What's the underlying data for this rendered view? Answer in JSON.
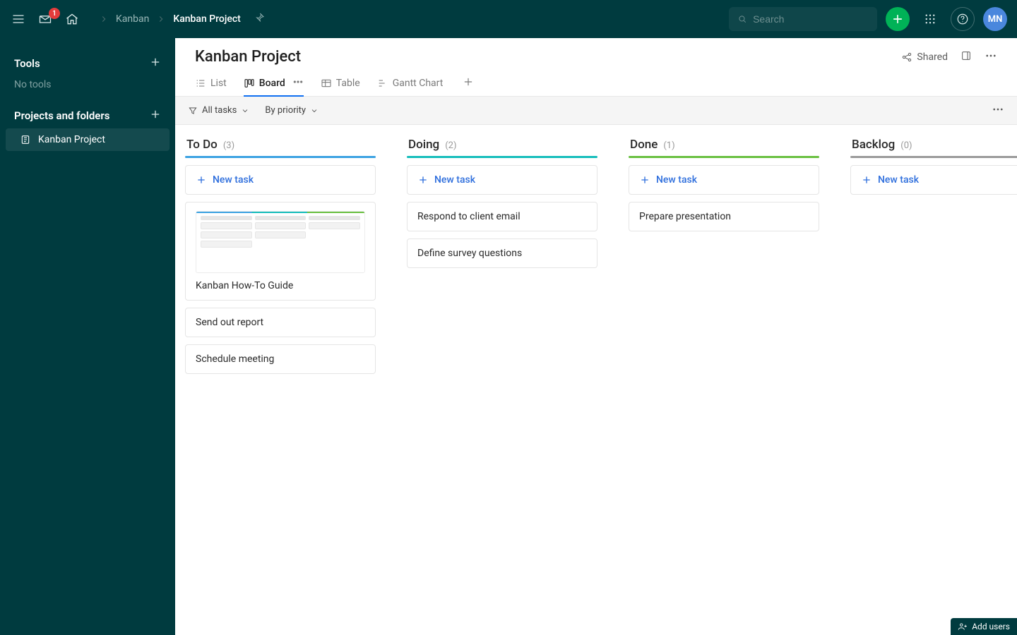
{
  "topbar": {
    "mail_badge": "1",
    "breadcrumbs": [
      {
        "label": "Kanban",
        "active": false
      },
      {
        "label": "Kanban Project",
        "active": true
      }
    ],
    "search_placeholder": "Search",
    "avatar_initials": "MN"
  },
  "sidebar": {
    "tools_label": "Tools",
    "no_tools_label": "No tools",
    "projects_label": "Projects and folders",
    "items": [
      {
        "label": "Kanban Project",
        "active": true
      }
    ]
  },
  "project": {
    "title": "Kanban Project",
    "shared_label": "Shared"
  },
  "views": {
    "list": "List",
    "board": "Board",
    "table": "Table",
    "gantt": "Gantt Chart"
  },
  "filters": {
    "all_tasks_label": "All tasks",
    "sort_label": "By priority"
  },
  "board": {
    "new_task_label": "New task",
    "columns": [
      {
        "key": "todo",
        "title": "To Do",
        "count": "(3)",
        "accent": "#3ba2e2",
        "cards": [
          {
            "title": "Kanban How-To Guide",
            "has_thumb": true
          },
          {
            "title": "Send out report"
          },
          {
            "title": "Schedule meeting"
          }
        ]
      },
      {
        "key": "doing",
        "title": "Doing",
        "count": "(2)",
        "accent": "#15bdbb",
        "cards": [
          {
            "title": "Respond to client email"
          },
          {
            "title": "Define survey questions"
          }
        ]
      },
      {
        "key": "done",
        "title": "Done",
        "count": "(1)",
        "accent": "#69c040",
        "cards": [
          {
            "title": "Prepare presentation"
          }
        ]
      },
      {
        "key": "backlog",
        "title": "Backlog",
        "count": "(0)",
        "accent": "#9a9a9a",
        "cards": []
      }
    ]
  },
  "footer": {
    "add_users_label": "Add users"
  }
}
